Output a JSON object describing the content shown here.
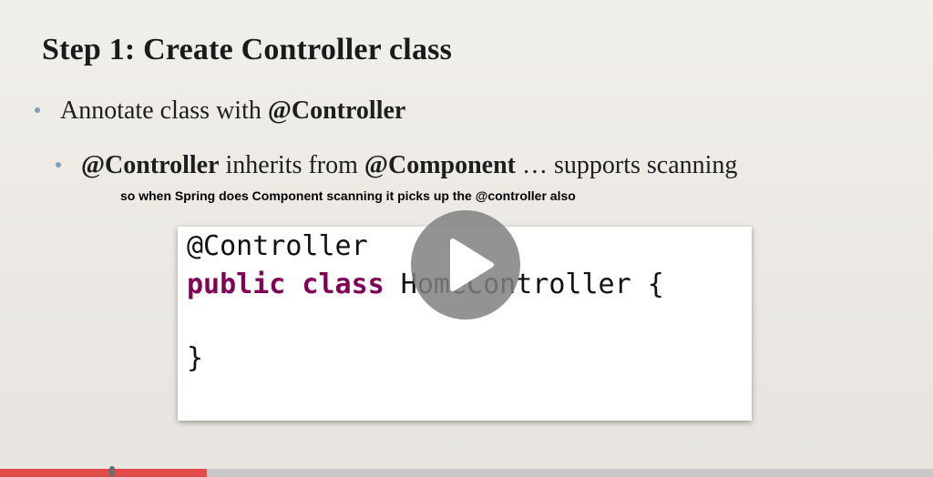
{
  "slide": {
    "title": "Step 1: Create Controller class",
    "bullet1": {
      "text": "Annotate class with ",
      "bold": "@Controller"
    },
    "bullet2": {
      "bold1": "@Controller",
      "text1": " inherits from ",
      "bold2": "@Component",
      "text2": " … supports scanning"
    },
    "caption": "so when Spring does Component scanning it picks up the @controller also"
  },
  "code": {
    "line1": "@Controller",
    "line2_kw": "public class",
    "line2_rest": " HomeController {",
    "line4": "}"
  },
  "player": {
    "play_icon": "play-icon",
    "progress_fraction": 0.222,
    "handle_fraction": 0.12,
    "progress_color": "#e34b4b",
    "track_color": "#c9c9cb"
  },
  "colors": {
    "keyword": "#7f0055",
    "bullet": "#7f9cb9"
  }
}
